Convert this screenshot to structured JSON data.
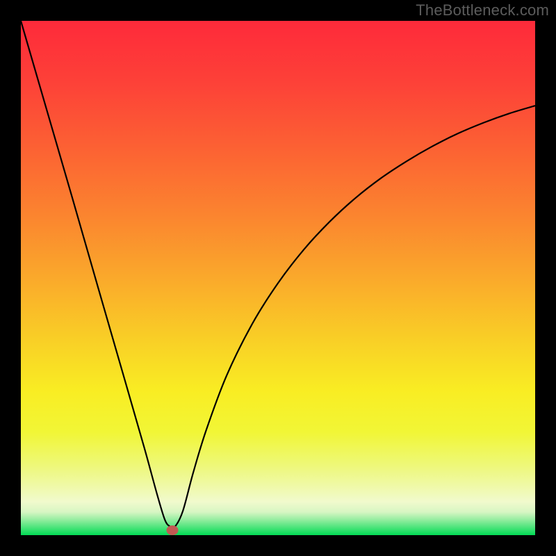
{
  "watermark": "TheBottleneck.com",
  "colors": {
    "frame": "#000000",
    "watermark_text": "#5c5c5c",
    "curve": "#000000",
    "marker": "#c15a53",
    "gradient_stops": [
      {
        "offset": 0.0,
        "color": "#fe2a3a"
      },
      {
        "offset": 0.12,
        "color": "#fd4138"
      },
      {
        "offset": 0.25,
        "color": "#fc6233"
      },
      {
        "offset": 0.38,
        "color": "#fb852f"
      },
      {
        "offset": 0.5,
        "color": "#faa92b"
      },
      {
        "offset": 0.62,
        "color": "#f9cf26"
      },
      {
        "offset": 0.72,
        "color": "#f9ed23"
      },
      {
        "offset": 0.8,
        "color": "#f1f636"
      },
      {
        "offset": 0.86,
        "color": "#eef874"
      },
      {
        "offset": 0.9,
        "color": "#eff9a2"
      },
      {
        "offset": 0.935,
        "color": "#f1facd"
      },
      {
        "offset": 0.955,
        "color": "#d7f6c3"
      },
      {
        "offset": 0.97,
        "color": "#94eda0"
      },
      {
        "offset": 0.985,
        "color": "#4be47a"
      },
      {
        "offset": 1.0,
        "color": "#02db55"
      }
    ]
  },
  "chart_data": {
    "type": "line",
    "title": "",
    "xlabel": "",
    "ylabel": "",
    "xlim": [
      0,
      1
    ],
    "ylim": [
      0,
      1
    ],
    "grid": false,
    "legend": false,
    "marker": {
      "x": 0.295,
      "y": 0.01
    },
    "series": [
      {
        "name": "curve",
        "x": [
          0.0,
          0.05,
          0.1,
          0.15,
          0.2,
          0.24,
          0.265,
          0.28,
          0.29,
          0.3,
          0.315,
          0.335,
          0.36,
          0.4,
          0.45,
          0.5,
          0.55,
          0.6,
          0.65,
          0.7,
          0.75,
          0.8,
          0.85,
          0.9,
          0.95,
          1.0
        ],
        "y": [
          1.0,
          0.828,
          0.656,
          0.482,
          0.309,
          0.17,
          0.079,
          0.03,
          0.017,
          0.017,
          0.047,
          0.121,
          0.203,
          0.31,
          0.411,
          0.49,
          0.555,
          0.609,
          0.655,
          0.694,
          0.727,
          0.756,
          0.781,
          0.802,
          0.82,
          0.835
        ]
      }
    ]
  }
}
